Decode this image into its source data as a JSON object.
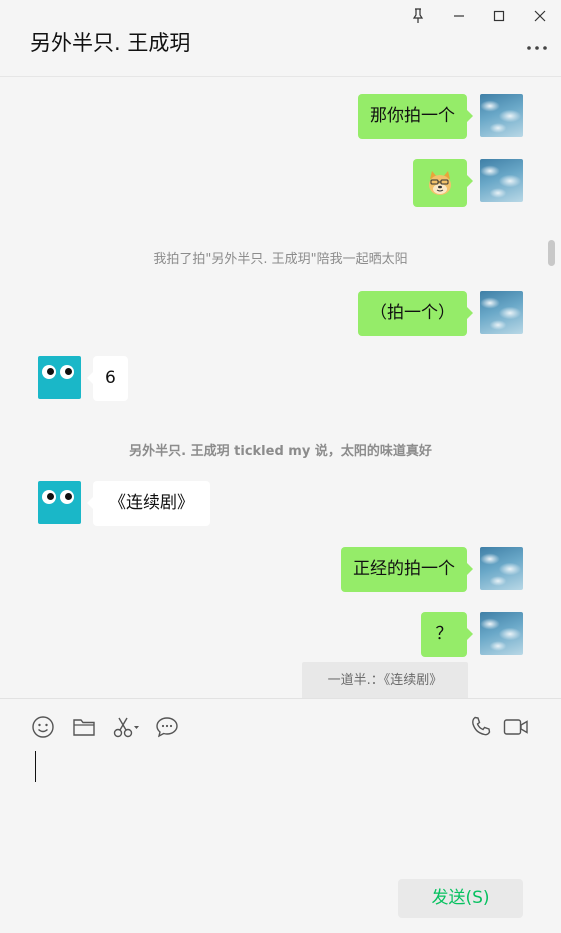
{
  "window": {
    "title": "另外半只. 王成玥",
    "controls": [
      "pin-icon",
      "minimize-icon",
      "maximize-icon",
      "close-icon"
    ],
    "more_icon": "more-dots-icon"
  },
  "colors": {
    "outgoing_bubble": "#95ec69",
    "incoming_bubble": "#ffffff",
    "send_text": "#07c160",
    "avatar_them": "#1ab7c8"
  },
  "messages": {
    "m1": "那你拍一个",
    "m2_emoji": "doge-emoji",
    "sys1": "我拍了拍\"另外半只. 王成玥\"陪我一起晒太阳",
    "m3": "（拍一个）",
    "m4": "6",
    "sys2": "另外半只. 王成玥 tickled my  说，太阳的味道真好",
    "m5": "《连续剧》",
    "m6": "正经的拍一个",
    "m7": "？"
  },
  "quote": {
    "text": "一道半.：《连续剧》"
  },
  "toolbar": {
    "left": [
      "emoji-icon",
      "folder-icon",
      "scissors-icon",
      "chat-bubble-icon"
    ],
    "right": [
      "phone-icon",
      "video-call-icon"
    ]
  },
  "input": {
    "value": ""
  },
  "send_button": {
    "label": "发送(S)"
  }
}
